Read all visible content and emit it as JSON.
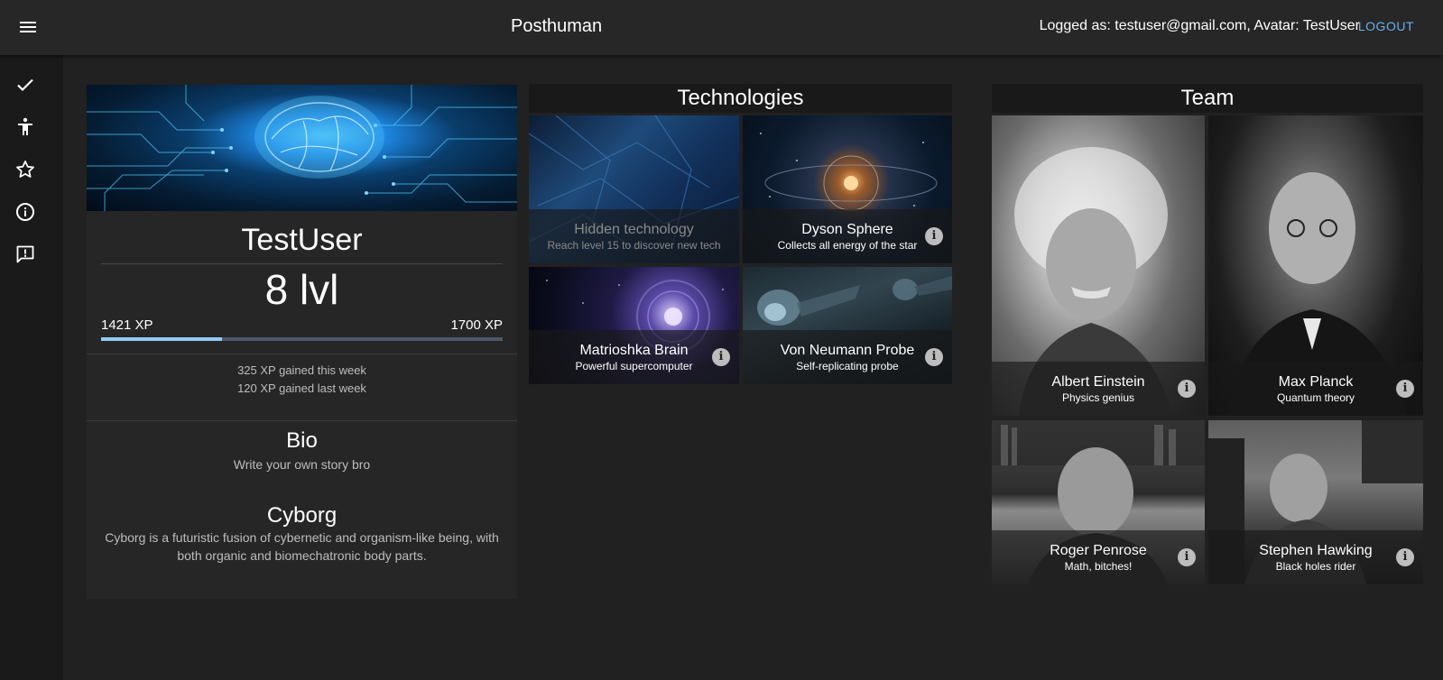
{
  "header": {
    "title": "Posthuman",
    "logged_text": "Logged as: testuser@gmail.com,  Avatar: TestUser",
    "logout_label": "LOGOUT"
  },
  "sidebar": {
    "items": [
      {
        "icon": "check-icon"
      },
      {
        "icon": "accessibility-icon"
      },
      {
        "icon": "star-icon"
      },
      {
        "icon": "info-icon"
      },
      {
        "icon": "feedback-icon"
      }
    ]
  },
  "profile": {
    "username": "TestUser",
    "level": "8 lvl",
    "xp_current": "1421 XP",
    "xp_max": "1700 XP",
    "xp_progress_fraction": 0.3,
    "gain_this_week": "325 XP gained this week",
    "gain_last_week": "120 XP gained last week",
    "bio_title": "Bio",
    "bio_text": "Write your own story bro",
    "class_title": "Cyborg",
    "class_text": "Cyborg is a futuristic fusion of cybernetic and organism-like being, with both organic and biomechatronic body parts."
  },
  "technologies": {
    "title": "Technologies",
    "items": [
      {
        "title": "Hidden technology",
        "subtitle": "Reach level 15 to discover new tech"
      },
      {
        "title": "Dyson Sphere",
        "subtitle": "Collects all energy of the star"
      },
      {
        "title": "Matrioshka Brain",
        "subtitle": "Powerful supercomputer"
      },
      {
        "title": "Von Neumann Probe",
        "subtitle": "Self-replicating probe"
      }
    ]
  },
  "team": {
    "title": "Team",
    "members": [
      {
        "name": "Albert Einstein",
        "subtitle": "Physics genius"
      },
      {
        "name": "Max Planck",
        "subtitle": "Quantum theory"
      },
      {
        "name": "Roger Penrose",
        "subtitle": "Math, bitches!"
      },
      {
        "name": "Stephen Hawking",
        "subtitle": "Black holes rider"
      }
    ]
  },
  "colors": {
    "accent": "#6ab0f0",
    "progress_fill": "#90caf9",
    "background": "#212121"
  }
}
